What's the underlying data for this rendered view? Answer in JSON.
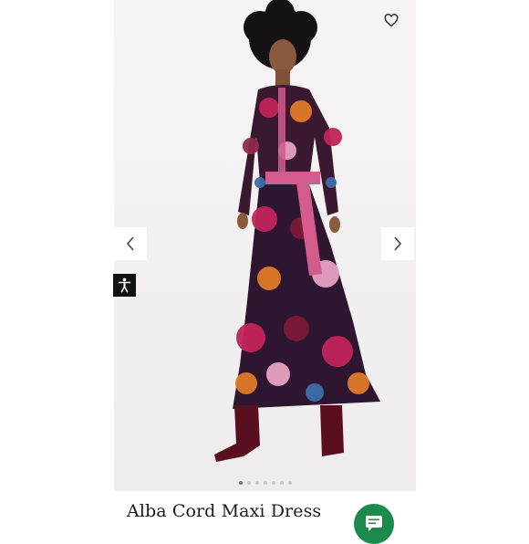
{
  "product": {
    "title": "Alba Cord Maxi Dress"
  },
  "icons": {
    "wishlist": "heart-outline-icon",
    "previous": "chevron-left-icon",
    "next": "chevron-right-icon",
    "accessibility": "accessibility-person-icon",
    "chat": "chat-message-icon"
  },
  "carousel": {
    "slide_count": 7,
    "active_index": 0
  },
  "colors": {
    "chat_button": "#1b8a4c",
    "accessibility_button": "#111111",
    "photo_background": "#f4f2f3"
  }
}
